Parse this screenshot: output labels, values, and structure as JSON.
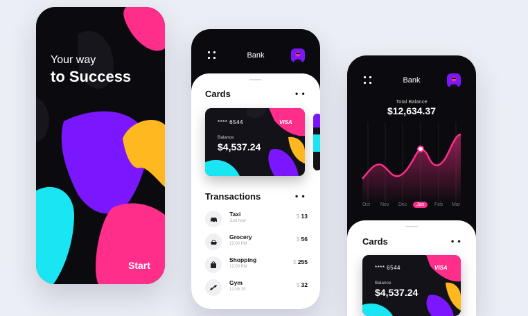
{
  "onboarding": {
    "line1": "Your way",
    "line2": "to Success",
    "start": "Start"
  },
  "bank_screen": {
    "title": "Bank",
    "cards_title": "Cards",
    "more": "• •",
    "card": {
      "number": "**** 6544",
      "brand": "VISA",
      "balance_label": "Balance",
      "balance": "$4,537.24"
    },
    "transactions_title": "Transactions",
    "currency": "$",
    "transactions": [
      {
        "name": "Taxi",
        "time": "Just now",
        "amount": "13",
        "icon": "car-icon"
      },
      {
        "name": "Grocery",
        "time": "12:00 PM",
        "amount": "56",
        "icon": "grocery-icon"
      },
      {
        "name": "Shopping",
        "time": "12:00 PM",
        "amount": "255",
        "icon": "shopping-bag-icon"
      },
      {
        "name": "Gym",
        "time": "12:06:19",
        "amount": "32",
        "icon": "dumbbell-icon"
      }
    ]
  },
  "balance_screen": {
    "title": "Bank",
    "total_label": "Total Balance",
    "total": "$12,634.37",
    "months": [
      "Oct",
      "Nov",
      "Dec",
      "Jan",
      "Feb",
      "Mar"
    ],
    "active_month": "Jan",
    "cards_title": "Cards",
    "more": "• •",
    "card": {
      "number": "**** 6544",
      "brand": "VISA",
      "balance_label": "Balance",
      "balance": "$4,537.24"
    }
  },
  "colors": {
    "pink": "#ff2e8a",
    "purple": "#7b17ff",
    "cyan": "#19e6f2",
    "yellow": "#ffb81f",
    "dark": "#0b0b0f"
  }
}
